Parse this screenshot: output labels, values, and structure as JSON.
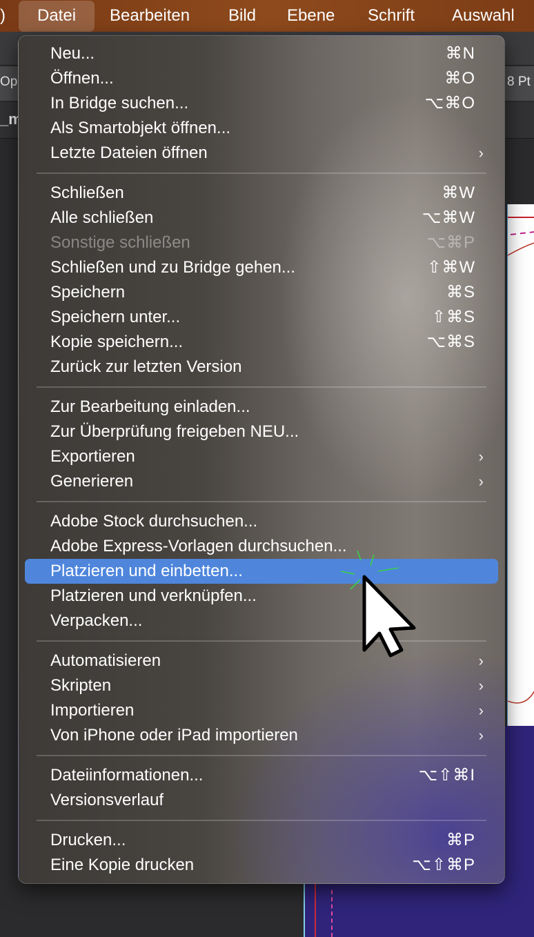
{
  "menubar": {
    "fragment": ")",
    "items": [
      "Datei",
      "Bearbeiten",
      "Bild",
      "Ebene",
      "Schrift",
      "Auswahl"
    ]
  },
  "background": {
    "toolbar_left_fragment": "Ope",
    "toolbar_right_fragment": "8 Pt",
    "tab_fragment": "_m"
  },
  "menu": {
    "groups": [
      [
        {
          "label": "Neu...",
          "shortcut": "⌘N"
        },
        {
          "label": "Öffnen...",
          "shortcut": "⌘O"
        },
        {
          "label": "In Bridge suchen...",
          "shortcut": "⌥⌘O"
        },
        {
          "label": "Als Smartobjekt öffnen...",
          "shortcut": ""
        },
        {
          "label": "Letzte Dateien öffnen",
          "shortcut": "",
          "submenu": true
        }
      ],
      [
        {
          "label": "Schließen",
          "shortcut": "⌘W"
        },
        {
          "label": "Alle schließen",
          "shortcut": "⌥⌘W"
        },
        {
          "label": "Sonstige schließen",
          "shortcut": "⌥⌘P",
          "disabled": true
        },
        {
          "label": "Schließen und zu Bridge gehen...",
          "shortcut": "⇧⌘W"
        },
        {
          "label": "Speichern",
          "shortcut": "⌘S"
        },
        {
          "label": "Speichern unter...",
          "shortcut": "⇧⌘S"
        },
        {
          "label": "Kopie speichern...",
          "shortcut": "⌥⌘S"
        },
        {
          "label": "Zurück zur letzten Version",
          "shortcut": ""
        }
      ],
      [
        {
          "label": "Zur Bearbeitung einladen...",
          "shortcut": ""
        },
        {
          "label": "Zur Überprüfung freigeben NEU...",
          "shortcut": ""
        },
        {
          "label": "Exportieren",
          "shortcut": "",
          "submenu": true
        },
        {
          "label": "Generieren",
          "shortcut": "",
          "submenu": true
        }
      ],
      [
        {
          "label": "Adobe Stock durchsuchen...",
          "shortcut": ""
        },
        {
          "label": "Adobe Express-Vorlagen durchsuchen...",
          "shortcut": ""
        },
        {
          "label": "Platzieren und einbetten...",
          "shortcut": "",
          "highlighted": true
        },
        {
          "label": "Platzieren und verknüpfen...",
          "shortcut": ""
        },
        {
          "label": "Verpacken...",
          "shortcut": ""
        }
      ],
      [
        {
          "label": "Automatisieren",
          "shortcut": "",
          "submenu": true
        },
        {
          "label": "Skripten",
          "shortcut": "",
          "submenu": true
        },
        {
          "label": "Importieren",
          "shortcut": "",
          "submenu": true
        },
        {
          "label": "Von iPhone oder iPad importieren",
          "shortcut": "",
          "submenu": true
        }
      ],
      [
        {
          "label": "Dateiinformationen...",
          "shortcut": "⌥⇧⌘I"
        },
        {
          "label": "Versionsverlauf",
          "shortcut": ""
        }
      ],
      [
        {
          "label": "Drucken...",
          "shortcut": "⌘P"
        },
        {
          "label": "Eine Kopie drucken",
          "shortcut": "⌥⇧⌘P"
        }
      ]
    ]
  },
  "colors": {
    "menubar": "#8e4a1c",
    "highlight": "#4f86dc",
    "disabled_text": "rgba(255,255,255,0.38)"
  }
}
